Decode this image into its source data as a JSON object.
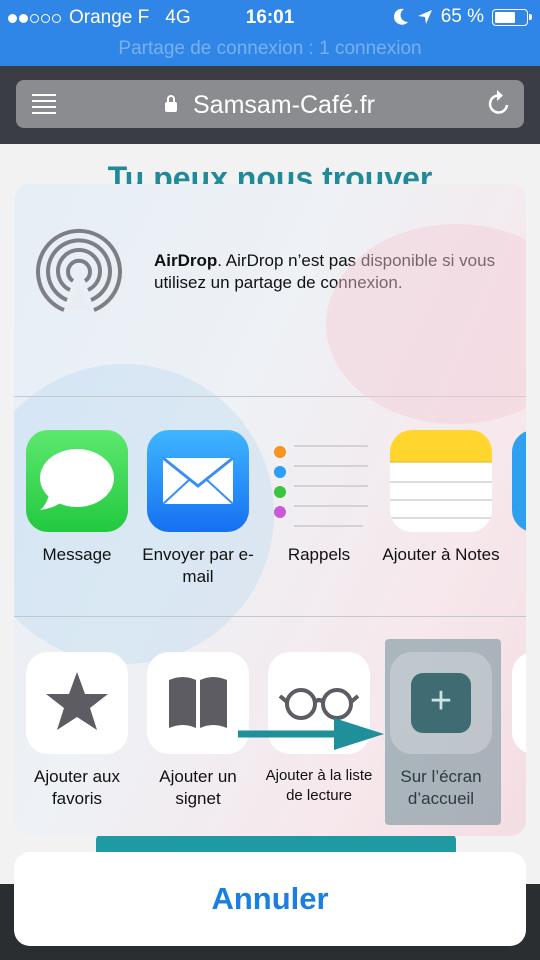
{
  "status_bar": {
    "carrier": "Orange F",
    "network": "4G",
    "time": "16:01",
    "battery": "65 %",
    "battery_level": 0.65
  },
  "hotspot_banner": "Partage de connexion : 1 connexion",
  "browser": {
    "url": "Samsam-Café.fr"
  },
  "webpage": {
    "heading": "Tu peux nous trouver"
  },
  "share_sheet": {
    "airdrop": {
      "title": "AirDrop",
      "description": ". AirDrop n’est pas disponible si vous utilisez un partage de connexion."
    },
    "apps": [
      {
        "label": "Message"
      },
      {
        "label": "Envoyer par e-mail"
      },
      {
        "label": "Rappels"
      },
      {
        "label": "Ajouter à Notes"
      }
    ],
    "actions": [
      {
        "label": "Ajouter aux favoris"
      },
      {
        "label": "Ajouter un signet"
      },
      {
        "label": "Ajouter à la liste de lecture"
      },
      {
        "label": "Sur l’écran d’accueil"
      }
    ],
    "cancel": "Annuler"
  },
  "colors": {
    "status_bar": "#2f86e6",
    "accent_teal": "#1f9aa2",
    "cancel_text": "#1a7fe0"
  }
}
